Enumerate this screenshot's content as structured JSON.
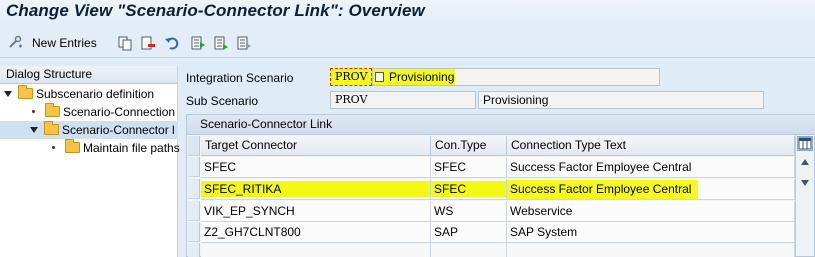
{
  "title": "Change View \"Scenario-Connector Link\": Overview",
  "toolbar": {
    "new_entries_label": "New Entries",
    "icons": [
      "customize-icon",
      "copy-icon",
      "delete-icon",
      "undo-icon",
      "select-all-icon",
      "select-block-icon",
      "deselect-all-icon"
    ]
  },
  "dialog_structure": {
    "header": "Dialog Structure",
    "items": [
      {
        "label": "Subscenario definition",
        "level": 0,
        "expanded": true
      },
      {
        "label": "Scenario-Connection",
        "level": 1
      },
      {
        "label": "Scenario-Connector l",
        "level": 1,
        "expanded": true,
        "selected": true
      },
      {
        "label": "Maintain file paths",
        "level": 2
      }
    ]
  },
  "fields": {
    "integration_scenario_label": "Integration Scenario",
    "integration_scenario_code": "PROV",
    "integration_scenario_text": "Provisioning",
    "sub_scenario_label": "Sub Scenario",
    "sub_scenario_code": "PROV",
    "sub_scenario_text": "Provisioning"
  },
  "table": {
    "title": "Scenario-Connector Link",
    "columns": [
      "Target Connector",
      "Con.Type",
      "Connection Type Text"
    ],
    "rows": [
      [
        "SFEC",
        "SFEC",
        "Success Factor Employee Central"
      ],
      [
        "SFEC_RITIKA",
        "SFEC",
        "Success Factor Employee Central"
      ],
      [
        "VIK_EP_SYNCH",
        "WS",
        "Webservice"
      ],
      [
        "Z2_GH7CLNT800",
        "SAP",
        "SAP System"
      ]
    ]
  },
  "colors": {
    "highlight": "#f6fa1c",
    "background": "#dfebf5",
    "title_text": "#0b1f3a"
  }
}
